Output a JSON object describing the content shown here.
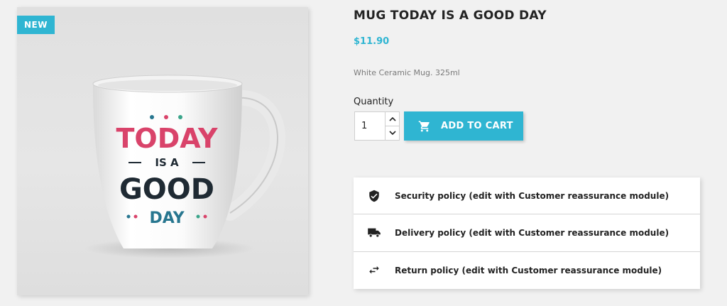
{
  "badge": "NEW",
  "mug_print": {
    "line1": "TODAY",
    "line2": "IS A",
    "line3": "GOOD",
    "line4": "DAY"
  },
  "product": {
    "title": "MUG TODAY IS A GOOD DAY",
    "price": "$11.90",
    "description": "White Ceramic Mug. 325ml"
  },
  "quantity": {
    "label": "Quantity",
    "value": "1"
  },
  "add_to_cart": {
    "label": "ADD TO CART",
    "icon": "cart-icon"
  },
  "reassurance": [
    {
      "icon": "shield-check-icon",
      "label": "Security policy (edit with Customer reassurance module)"
    },
    {
      "icon": "truck-icon",
      "label": "Delivery policy (edit with Customer reassurance module)"
    },
    {
      "icon": "swap-arrows-icon",
      "label": "Return policy (edit with Customer reassurance module)"
    }
  ],
  "colors": {
    "accent": "#2fb5d2",
    "text": "#232323",
    "mug_pink": "#d9436a",
    "mug_dark": "#1f2a33",
    "mug_blue": "#27768f"
  }
}
